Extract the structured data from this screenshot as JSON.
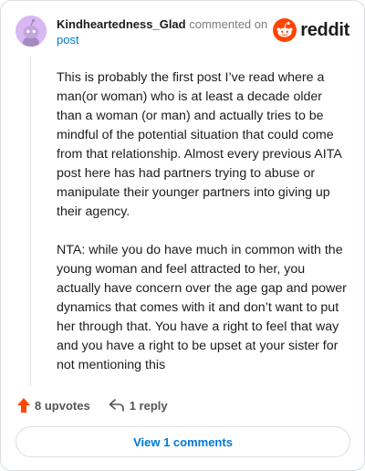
{
  "comment": {
    "username": "Kindheartedness_Glad",
    "action_text": "commented on",
    "post_link_label": "post",
    "paragraphs": [
      "This is probably the first post I’ve read where a man(or woman) who is at least a decade older than a woman (or man) and actually tries to be mindful of the potential situation that could come from that relationship. Almost every previous AITA post here has had partners trying to abuse or manipulate their younger partners into giving up their agency.",
      "NTA: while you do have much in common with the young woman and feel attracted to her, you actually have concern over the age gap and power dynamics that comes with it and don’t want to put her through that. You have a right to feel that way and you have a right to be upset at your sister for not mentioning this"
    ],
    "upvotes_label": "8 upvotes",
    "reply_label": "1 reply"
  },
  "brand": {
    "name": "reddit",
    "color": "#ff4500"
  },
  "footer": {
    "view_comments_label": "View 1 comments"
  },
  "colors": {
    "link": "#0079d3",
    "upvote": "#ff4500",
    "avatar_bg": "#d7b8f3"
  }
}
